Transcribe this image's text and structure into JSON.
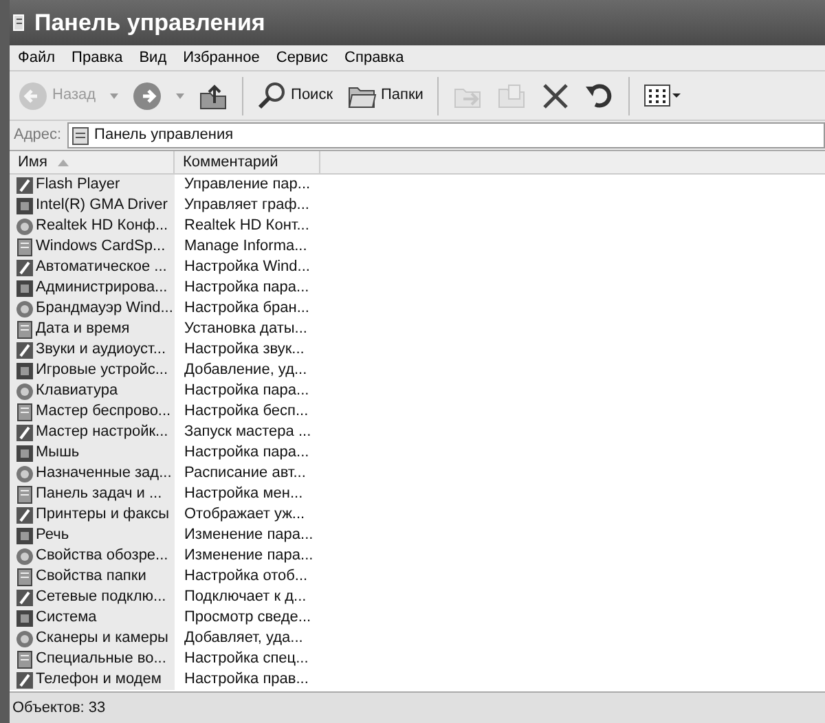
{
  "window": {
    "title": "Панель управления"
  },
  "menu": [
    "Файл",
    "Правка",
    "Вид",
    "Избранное",
    "Сервис",
    "Справка"
  ],
  "toolbar": [
    {
      "kind": "back",
      "label": "Назад",
      "disabled": true
    },
    {
      "kind": "forward",
      "disabled": false
    },
    {
      "kind": "up",
      "disabled": false
    },
    {
      "kind": "sep"
    },
    {
      "kind": "search",
      "label": "Поиск",
      "disabled": false
    },
    {
      "kind": "folders",
      "label": "Папки",
      "disabled": false
    },
    {
      "kind": "sep"
    },
    {
      "kind": "move",
      "disabled": true
    },
    {
      "kind": "copy",
      "disabled": true
    },
    {
      "kind": "delete",
      "disabled": false
    },
    {
      "kind": "undo",
      "disabled": false
    },
    {
      "kind": "sep"
    },
    {
      "kind": "views",
      "disabled": false
    }
  ],
  "address": {
    "label": "Адрес:",
    "value": "Панель управления"
  },
  "table": {
    "columns": [
      {
        "label": "Имя",
        "sorted": true
      },
      {
        "label": "Комментарий",
        "sorted": false
      }
    ],
    "rows": [
      {
        "name": "Flash Player",
        "comment": "Управление пар..."
      },
      {
        "name": "Intel(R) GMA Driver",
        "comment": "Управляет граф..."
      },
      {
        "name": "Realtek HD Конф...",
        "comment": "Realtek HD Конт..."
      },
      {
        "name": "Windows CardSp...",
        "comment": "Manage Informa..."
      },
      {
        "name": "Автоматическое ...",
        "comment": "Настройка Wind..."
      },
      {
        "name": "Администрирова...",
        "comment": "Настройка пара..."
      },
      {
        "name": "Брандмауэр Wind...",
        "comment": "Настройка бран..."
      },
      {
        "name": "Дата и время",
        "comment": "Установка даты..."
      },
      {
        "name": "Звуки и аудиоуст...",
        "comment": "Настройка звук..."
      },
      {
        "name": "Игровые устройс...",
        "comment": "Добавление, уд..."
      },
      {
        "name": "Клавиатура",
        "comment": "Настройка пара..."
      },
      {
        "name": "Мастер беспрово...",
        "comment": "Настройка бесп..."
      },
      {
        "name": "Мастер настройк...",
        "comment": "Запуск мастера ..."
      },
      {
        "name": "Мышь",
        "comment": "Настройка пара..."
      },
      {
        "name": "Назначенные зад...",
        "comment": "Расписание авт..."
      },
      {
        "name": "Панель задач и ...",
        "comment": "Настройка мен..."
      },
      {
        "name": "Принтеры и факсы",
        "comment": "Отображает уж..."
      },
      {
        "name": "Речь",
        "comment": "Изменение пара..."
      },
      {
        "name": "Свойства обозре...",
        "comment": "Изменение пара..."
      },
      {
        "name": "Свойства папки",
        "comment": "Настройка отоб..."
      },
      {
        "name": "Сетевые подклю...",
        "comment": "Подключает к д..."
      },
      {
        "name": "Система",
        "comment": "Просмотр сведе..."
      },
      {
        "name": "Сканеры и камеры",
        "comment": "Добавляет, уда..."
      },
      {
        "name": "Специальные во...",
        "comment": "Настройка спец..."
      },
      {
        "name": "Телефон и модем",
        "comment": "Настройка прав..."
      }
    ]
  },
  "status_bar": "Объектов: 33"
}
